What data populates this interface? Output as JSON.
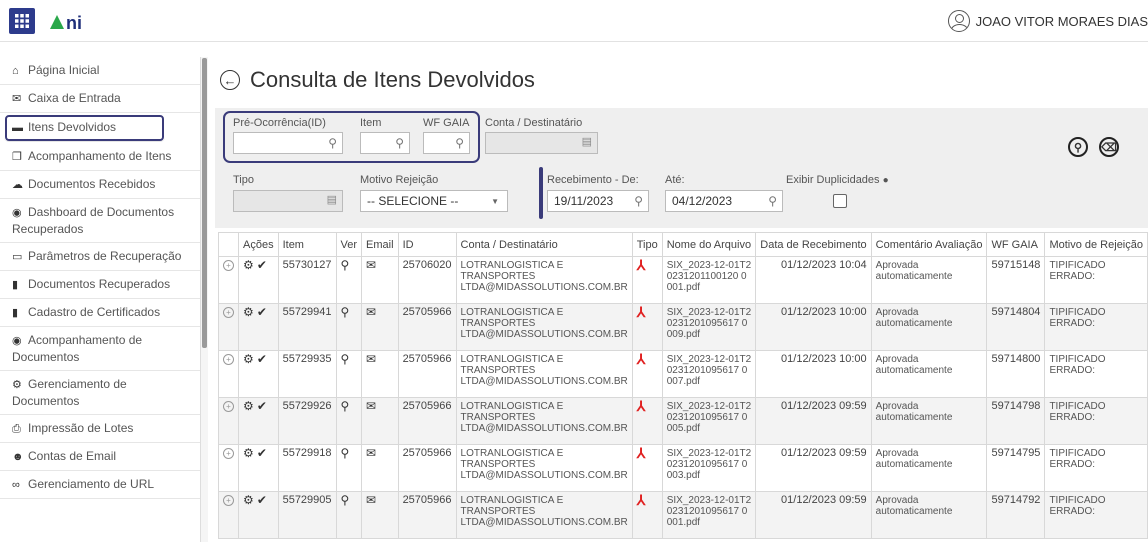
{
  "topbar": {
    "logo": "ANI",
    "user_name": "JOAO VITOR MORAES DIAS"
  },
  "sidebar": {
    "items": [
      {
        "label": "Página Inicial",
        "icon": "home-icon"
      },
      {
        "label": "Caixa de Entrada",
        "icon": "envelope-icon"
      },
      {
        "label": "Itens Devolvidos",
        "icon": "inbox-icon"
      },
      {
        "label": "Acompanhamento de Itens",
        "icon": "copy-icon"
      },
      {
        "label": "Documentos Recebidos",
        "icon": "cloud-icon"
      },
      {
        "label": "Dashboard de Documentos Recuperados",
        "icon": "dashboard-icon"
      },
      {
        "label": "Parâmetros de Recuperação",
        "icon": "keyboard-icon"
      },
      {
        "label": "Documentos Recuperados",
        "icon": "file-icon"
      },
      {
        "label": "Cadastro de Certificados",
        "icon": "file-icon"
      },
      {
        "label": "Acompanhamento de Documentos",
        "icon": "eye-icon"
      },
      {
        "label": "Gerenciamento de Documentos",
        "icon": "cogs-icon"
      },
      {
        "label": "Impressão de Lotes",
        "icon": "print-icon"
      },
      {
        "label": "Contas de Email",
        "icon": "users-icon"
      },
      {
        "label": "Gerenciamento de URL",
        "icon": "link-icon"
      }
    ]
  },
  "main": {
    "title": "Consulta de Itens Devolvidos",
    "filters": {
      "pre_ocorrencia_label": "Pré-Ocorrência(ID)",
      "item_label": "Item",
      "wf_gaia_label": "WF GAIA",
      "conta_label": "Conta / Destinatário",
      "tipo_label": "Tipo",
      "motivo_label": "Motivo Rejeição",
      "motivo_value": "-- SELECIONE --",
      "receb_de_label": "Recebimento - De:",
      "receb_de_value": "19/11/2023",
      "ate_label": "Até:",
      "ate_value": "04/12/2023",
      "duplicidades_label": "Exibir Duplicidades"
    },
    "table": {
      "headers": [
        "",
        "Ações",
        "Item",
        "Ver",
        "Email",
        "ID",
        "Conta / Destinatário",
        "Tipo",
        "Nome do Arquivo",
        "Data de Recebimento",
        "Comentário Avaliação",
        "WF GAIA",
        "Motivo de Rejeição"
      ],
      "rows": [
        {
          "item": "55730127",
          "id": "25706020",
          "conta": "LOTRANLOGISTICA E TRANSPORTES LTDA@MIDASSOLUTIONS.COM.BR",
          "arquivo": "SIX_2023-12-01T20231201100120 0001.pdf",
          "data": "01/12/2023 10:04",
          "comentario": "Aprovada automaticamente",
          "wf": "59715148",
          "motivo": "TIPIFICADO ERRADO:"
        },
        {
          "item": "55729941",
          "id": "25705966",
          "conta": "LOTRANLOGISTICA E TRANSPORTES LTDA@MIDASSOLUTIONS.COM.BR",
          "arquivo": "SIX_2023-12-01T20231201095617 0009.pdf",
          "data": "01/12/2023 10:00",
          "comentario": "Aprovada automaticamente",
          "wf": "59714804",
          "motivo": "TIPIFICADO ERRADO:"
        },
        {
          "item": "55729935",
          "id": "25705966",
          "conta": "LOTRANLOGISTICA E TRANSPORTES LTDA@MIDASSOLUTIONS.COM.BR",
          "arquivo": "SIX_2023-12-01T20231201095617 0007.pdf",
          "data": "01/12/2023 10:00",
          "comentario": "Aprovada automaticamente",
          "wf": "59714800",
          "motivo": "TIPIFICADO ERRADO:"
        },
        {
          "item": "55729926",
          "id": "25705966",
          "conta": "LOTRANLOGISTICA E TRANSPORTES LTDA@MIDASSOLUTIONS.COM.BR",
          "arquivo": "SIX_2023-12-01T20231201095617 0005.pdf",
          "data": "01/12/2023 09:59",
          "comentario": "Aprovada automaticamente",
          "wf": "59714798",
          "motivo": "TIPIFICADO ERRADO:"
        },
        {
          "item": "55729918",
          "id": "25705966",
          "conta": "LOTRANLOGISTICA E TRANSPORTES LTDA@MIDASSOLUTIONS.COM.BR",
          "arquivo": "SIX_2023-12-01T20231201095617 0003.pdf",
          "data": "01/12/2023 09:59",
          "comentario": "Aprovada automaticamente",
          "wf": "59714795",
          "motivo": "TIPIFICADO ERRADO:"
        },
        {
          "item": "55729905",
          "id": "25705966",
          "conta": "LOTRANLOGISTICA E TRANSPORTES LTDA@MIDASSOLUTIONS.COM.BR",
          "arquivo": "SIX_2023-12-01T20231201095617 0001.pdf",
          "data": "01/12/2023 09:59",
          "comentario": "Aprovada automaticamente",
          "wf": "59714792",
          "motivo": "TIPIFICADO ERRADO:"
        }
      ]
    }
  }
}
